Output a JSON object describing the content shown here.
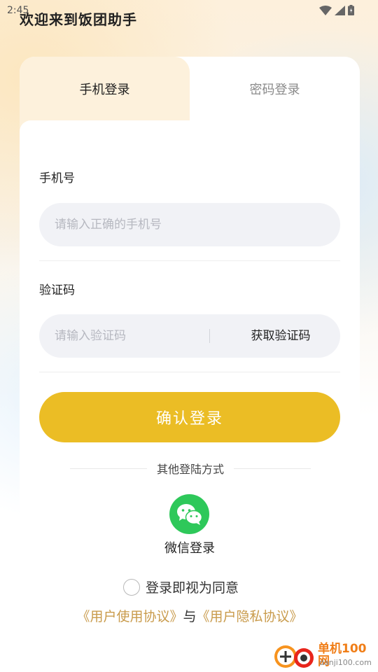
{
  "status_bar": {
    "time": "2:45"
  },
  "header": {
    "title": "欢迎来到饭团助手"
  },
  "tabs": {
    "phone_login": "手机登录",
    "password_login": "密码登录"
  },
  "phone": {
    "label": "手机号",
    "placeholder": "请输入正确的手机号"
  },
  "code": {
    "label": "验证码",
    "placeholder": "请输入验证码",
    "get_code": "获取验证码"
  },
  "confirm_label": "确认登录",
  "other_methods": "其他登陆方式",
  "wechat": {
    "label": "微信登录"
  },
  "agreement": {
    "prefix": "登录即视为同意",
    "user_agreement": "《用户使用协议》",
    "and": "与",
    "privacy_agreement": "《用户隐私协议》"
  },
  "watermark": {
    "name": "单机100网",
    "domain": "danji100.com"
  },
  "colors": {
    "accent": "#ebbd25",
    "link": "#c99b4c",
    "wechat": "#2ec85a"
  }
}
